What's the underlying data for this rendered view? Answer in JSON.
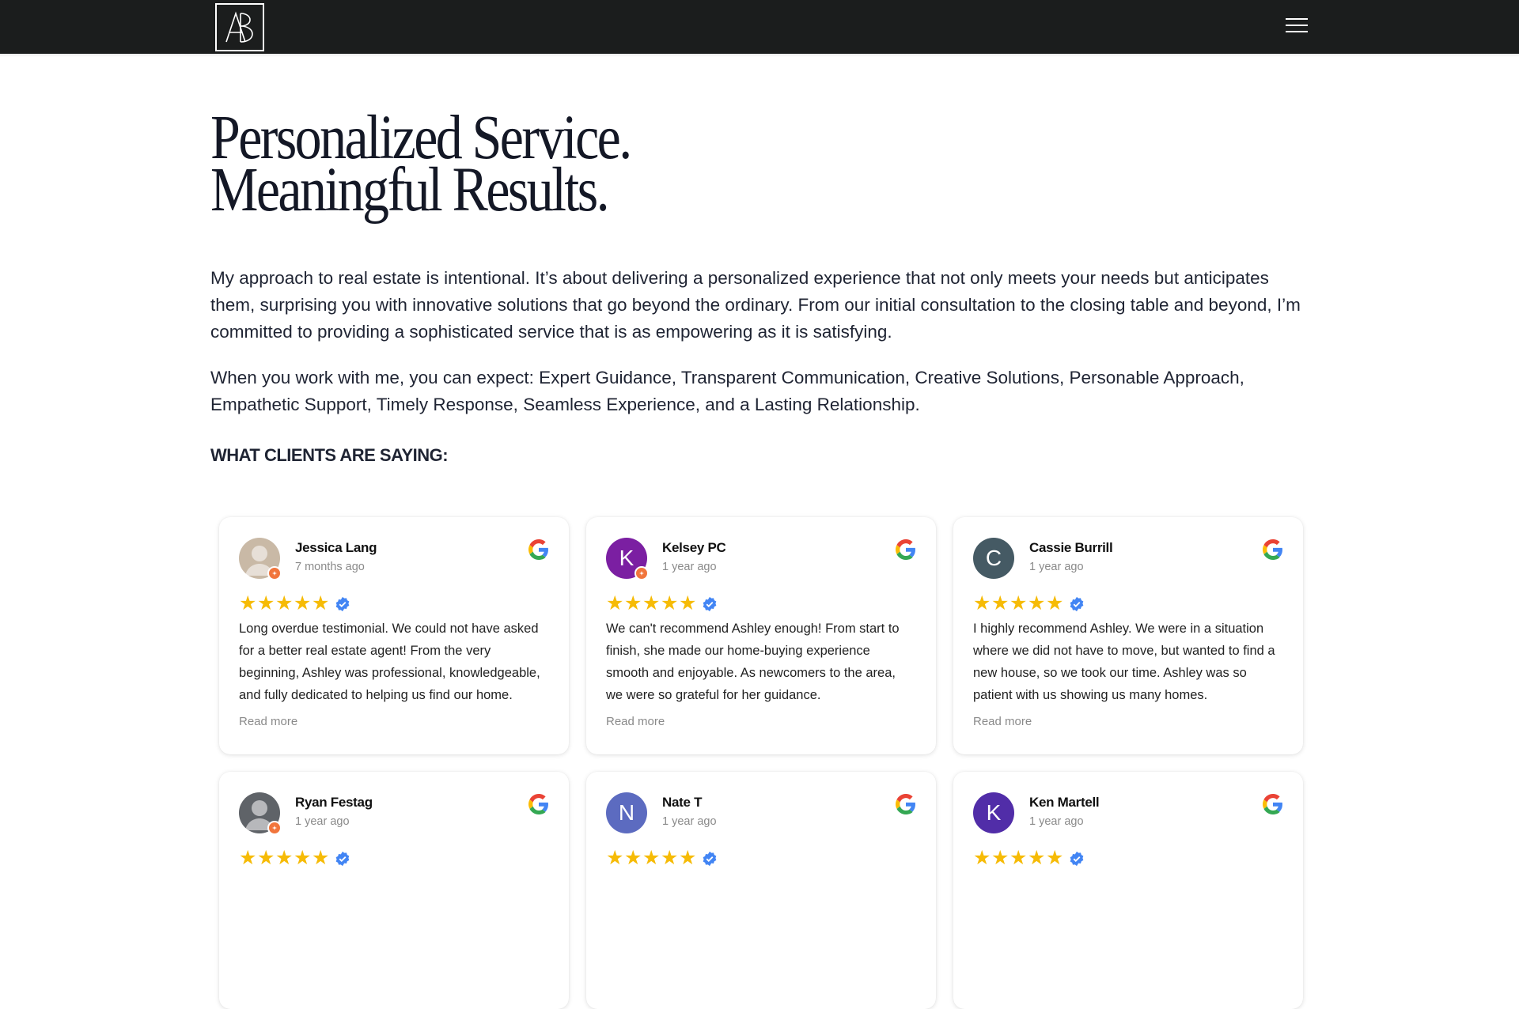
{
  "header": {
    "logo_letters": "AB",
    "menu_icon": "hamburger-menu-icon"
  },
  "main": {
    "headline_line1": "Personalized Service.",
    "headline_line2": "Meaningful Results.",
    "paragraph1": "My approach to real estate is intentional. It’s about delivering a personalized experience that not only meets your needs but anticipates them, surprising you with innovative solutions that go beyond the ordinary. From our initial consultation to the closing table and beyond, I’m committed to providing a sophisticated service that is as empowering as it is satisfying.",
    "paragraph2": "When you work with me, you can expect: Expert Guidance, Transparent Communication, Creative Solutions, Personable Approach, Empathetic Support, Timely Response, Seamless Experience, and a Lasting Relationship.",
    "clients_heading": "WHAT CLIENTS ARE SAYING:"
  },
  "reviews": [
    {
      "name": "Jessica Lang",
      "date": "7 months ago",
      "avatar_initial": "",
      "avatar_color": "#c9b9a6",
      "rating": 5,
      "text": "Long overdue testimonial. We could not have asked for a better real estate agent! From the very beginning, Ashley was professional, knowledgeable, and fully dedicated to helping us find our home.",
      "read_more": "Read more"
    },
    {
      "name": "Kelsey PC",
      "date": "1 year ago",
      "avatar_initial": "K",
      "avatar_color": "#7b1fa2",
      "rating": 5,
      "text": "We can't recommend Ashley enough! From start to finish, she made our home-buying experience smooth and enjoyable. As newcomers to the area, we were so grateful for her guidance.",
      "read_more": "Read more"
    },
    {
      "name": "Cassie Burrill",
      "date": "1 year ago",
      "avatar_initial": "C",
      "avatar_color": "#455a64",
      "rating": 5,
      "text": "I highly recommend Ashley. We were in a situation where we did not have to move, but wanted to find a new house, so we took our time. Ashley was so patient with us showing us many homes.",
      "read_more": "Read more"
    },
    {
      "name": "Ryan Festag",
      "date": "1 year ago",
      "avatar_initial": "",
      "avatar_color": "#5f6368",
      "rating": 5,
      "text": "",
      "read_more": ""
    },
    {
      "name": "Nate T",
      "date": "1 year ago",
      "avatar_initial": "N",
      "avatar_color": "#5c6bc0",
      "rating": 5,
      "text": "",
      "read_more": ""
    },
    {
      "name": "Ken Martell",
      "date": "1 year ago",
      "avatar_initial": "K",
      "avatar_color": "#512da8",
      "rating": 5,
      "text": "",
      "read_more": ""
    }
  ],
  "colors": {
    "topbar": "#1b1d1d",
    "star": "#f6bb06",
    "verified": "#4285f4",
    "text": "#1f2433"
  }
}
